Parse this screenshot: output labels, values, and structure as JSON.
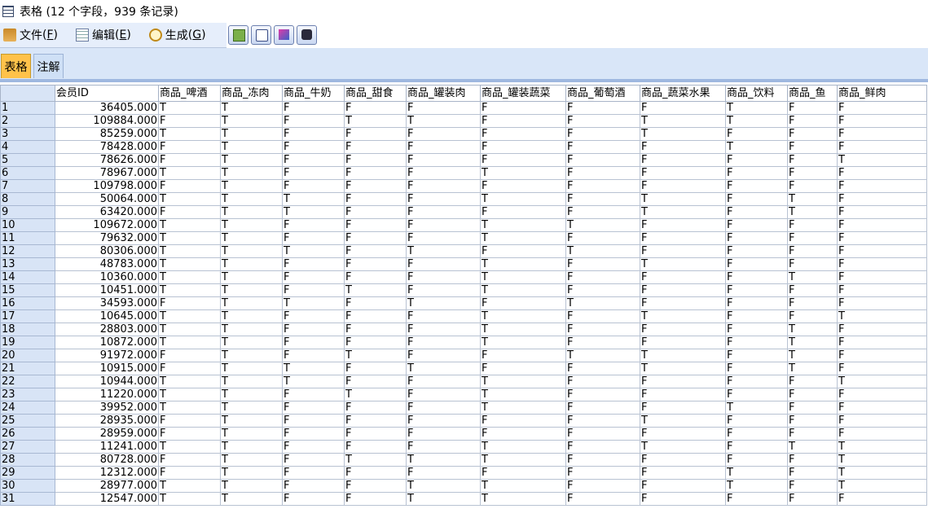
{
  "window": {
    "title": "表格 (12 个字段，939 条记录)"
  },
  "menu": [
    {
      "label": "文件",
      "key": "F",
      "icon": "file-icon"
    },
    {
      "label": "编辑",
      "key": "E",
      "icon": "edit-icon"
    },
    {
      "label": "生成",
      "key": "G",
      "icon": "generate-icon"
    }
  ],
  "toolbar": [
    {
      "name": "export-button",
      "icon": "export-icon"
    },
    {
      "name": "print-button",
      "icon": "printer-icon"
    },
    {
      "name": "chart-button",
      "icon": "chart-icon"
    },
    {
      "name": "find-button",
      "icon": "binoculars-icon"
    }
  ],
  "tabs": [
    {
      "label": "表格",
      "active": true
    },
    {
      "label": "注解",
      "active": false
    }
  ],
  "table": {
    "columns": [
      "会员ID",
      "商品_啤酒",
      "商品_冻肉",
      "商品_牛奶",
      "商品_甜食",
      "商品_罐装肉",
      "商品_罐装蔬菜",
      "商品_葡萄酒",
      "商品_蔬菜水果",
      "商品_饮料",
      "商品_鱼",
      "商品_鲜肉"
    ],
    "rows": [
      [
        "36405.000",
        "T",
        "T",
        "F",
        "F",
        "F",
        "F",
        "F",
        "F",
        "T",
        "F",
        "F"
      ],
      [
        "109884.000",
        "F",
        "T",
        "F",
        "T",
        "T",
        "F",
        "F",
        "T",
        "T",
        "F",
        "F"
      ],
      [
        "85259.000",
        "T",
        "T",
        "F",
        "F",
        "F",
        "F",
        "F",
        "T",
        "F",
        "F",
        "F"
      ],
      [
        "78428.000",
        "F",
        "T",
        "F",
        "F",
        "F",
        "F",
        "F",
        "F",
        "T",
        "F",
        "F"
      ],
      [
        "78626.000",
        "F",
        "T",
        "F",
        "F",
        "F",
        "F",
        "F",
        "F",
        "F",
        "F",
        "T"
      ],
      [
        "78967.000",
        "T",
        "T",
        "F",
        "F",
        "F",
        "T",
        "F",
        "F",
        "F",
        "F",
        "F"
      ],
      [
        "109798.000",
        "F",
        "T",
        "F",
        "F",
        "F",
        "F",
        "F",
        "F",
        "F",
        "F",
        "F"
      ],
      [
        "50064.000",
        "T",
        "T",
        "T",
        "F",
        "F",
        "T",
        "F",
        "T",
        "F",
        "T",
        "F"
      ],
      [
        "63420.000",
        "F",
        "T",
        "T",
        "F",
        "F",
        "F",
        "F",
        "T",
        "F",
        "T",
        "F"
      ],
      [
        "109672.000",
        "T",
        "T",
        "F",
        "F",
        "F",
        "T",
        "T",
        "F",
        "F",
        "F",
        "F"
      ],
      [
        "79632.000",
        "T",
        "T",
        "F",
        "F",
        "F",
        "T",
        "F",
        "F",
        "F",
        "F",
        "F"
      ],
      [
        "80306.000",
        "T",
        "T",
        "T",
        "F",
        "T",
        "F",
        "T",
        "F",
        "F",
        "F",
        "F"
      ],
      [
        "48783.000",
        "T",
        "T",
        "F",
        "F",
        "F",
        "T",
        "F",
        "T",
        "F",
        "F",
        "F"
      ],
      [
        "10360.000",
        "T",
        "T",
        "F",
        "F",
        "F",
        "T",
        "F",
        "F",
        "F",
        "T",
        "F"
      ],
      [
        "10451.000",
        "T",
        "T",
        "F",
        "T",
        "F",
        "T",
        "F",
        "F",
        "F",
        "F",
        "F"
      ],
      [
        "34593.000",
        "F",
        "T",
        "T",
        "F",
        "T",
        "F",
        "T",
        "F",
        "F",
        "F",
        "F"
      ],
      [
        "10645.000",
        "T",
        "T",
        "F",
        "F",
        "F",
        "T",
        "F",
        "T",
        "F",
        "F",
        "T"
      ],
      [
        "28803.000",
        "T",
        "T",
        "F",
        "F",
        "F",
        "T",
        "F",
        "F",
        "F",
        "T",
        "F"
      ],
      [
        "10872.000",
        "T",
        "T",
        "F",
        "F",
        "F",
        "T",
        "F",
        "F",
        "F",
        "T",
        "F"
      ],
      [
        "91972.000",
        "F",
        "T",
        "F",
        "T",
        "F",
        "F",
        "T",
        "T",
        "F",
        "T",
        "F"
      ],
      [
        "10915.000",
        "F",
        "T",
        "T",
        "F",
        "T",
        "F",
        "F",
        "T",
        "F",
        "T",
        "F"
      ],
      [
        "10944.000",
        "T",
        "T",
        "T",
        "F",
        "F",
        "T",
        "F",
        "F",
        "F",
        "F",
        "T"
      ],
      [
        "11220.000",
        "T",
        "T",
        "F",
        "T",
        "F",
        "T",
        "F",
        "F",
        "F",
        "F",
        "F"
      ],
      [
        "39952.000",
        "T",
        "T",
        "F",
        "F",
        "F",
        "T",
        "F",
        "F",
        "T",
        "F",
        "F"
      ],
      [
        "28935.000",
        "F",
        "T",
        "F",
        "F",
        "F",
        "F",
        "F",
        "T",
        "F",
        "F",
        "F"
      ],
      [
        "28959.000",
        "F",
        "T",
        "F",
        "F",
        "F",
        "F",
        "F",
        "F",
        "F",
        "F",
        "F"
      ],
      [
        "11241.000",
        "T",
        "T",
        "F",
        "F",
        "F",
        "T",
        "F",
        "T",
        "F",
        "T",
        "T"
      ],
      [
        "80728.000",
        "F",
        "T",
        "F",
        "T",
        "T",
        "T",
        "F",
        "F",
        "F",
        "F",
        "T"
      ],
      [
        "12312.000",
        "F",
        "T",
        "F",
        "F",
        "F",
        "F",
        "F",
        "F",
        "T",
        "F",
        "T"
      ],
      [
        "28977.000",
        "T",
        "T",
        "F",
        "F",
        "T",
        "T",
        "F",
        "F",
        "T",
        "F",
        "T"
      ],
      [
        "12547.000",
        "T",
        "T",
        "F",
        "F",
        "T",
        "T",
        "F",
        "F",
        "F",
        "F",
        "F"
      ]
    ]
  }
}
